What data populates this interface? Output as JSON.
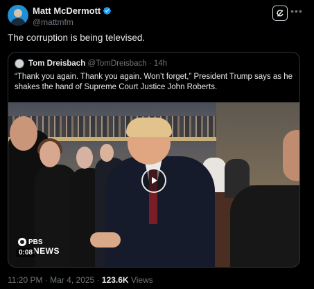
{
  "author": {
    "display_name": "Matt McDermott",
    "handle": "@mattmfm",
    "verified": true
  },
  "tweet": {
    "text": "The corruption is being televised."
  },
  "quoted": {
    "display_name": "Tom Dreisbach",
    "handle": "@TomDreisbach",
    "separator": "·",
    "time": "14h",
    "text": "“Thank you again. Thank you again. Won’t forget,” President Trump says as he shakes the hand of Supreme Court Justice John Roberts.",
    "video": {
      "duration": "0:08",
      "logo_text": "PBS",
      "logo_sub": "NEWS"
    }
  },
  "meta": {
    "time": "11:20 PM",
    "separator": "·",
    "date": "Mar 4, 2025",
    "views_count": "123.6K",
    "views_label": "Views"
  },
  "icons": {
    "verified": "verified-badge-icon",
    "grok": "grok-icon",
    "more": "more-icon",
    "play": "play-icon"
  },
  "colors": {
    "background": "#000000",
    "text": "#e7e9ea",
    "muted": "#71767b",
    "border": "#2f3336",
    "verified": "#1d9bf0"
  }
}
